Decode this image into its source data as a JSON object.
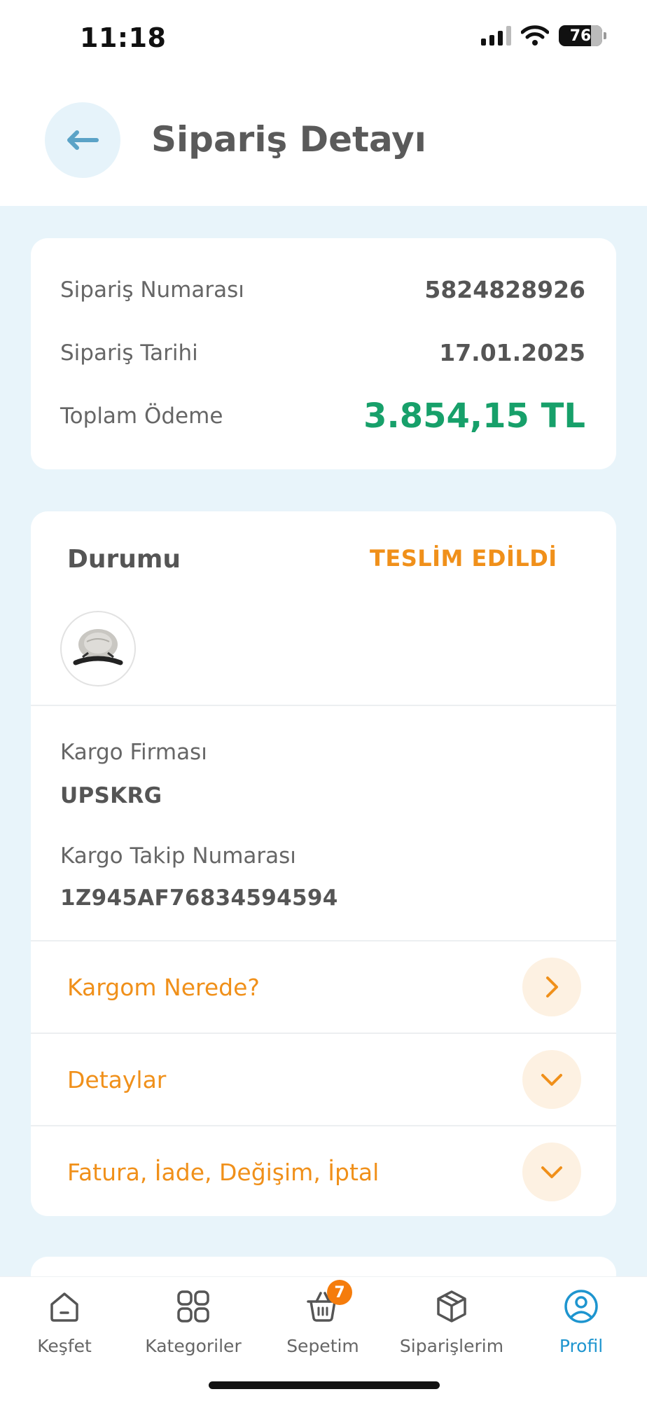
{
  "status_bar": {
    "time": "11:18",
    "battery": "76"
  },
  "header": {
    "title": "Sipariş Detayı"
  },
  "summary": {
    "order_number_label": "Sipariş Numarası",
    "order_number": "5824828926",
    "order_date_label": "Sipariş Tarihi",
    "order_date": "17.01.2025",
    "total_label": "Toplam Ödeme",
    "total": "3.854,15 TL"
  },
  "order_status": {
    "label": "Durumu",
    "value": "TESLİM EDİLDİ",
    "cargo_company_label": "Kargo Firması",
    "cargo_company": "UPSKRG",
    "tracking_label": "Kargo Takip Numarası",
    "tracking_number": "1Z945AF76834594594"
  },
  "actions": {
    "where_is_cargo": "Kargom Nerede?",
    "details": "Detaylar",
    "invoice_return": "Fatura, İade, Değişim, İptal"
  },
  "tab_bar": {
    "items": [
      {
        "label": "Keşfet",
        "icon": "home-icon"
      },
      {
        "label": "Kategoriler",
        "icon": "grid-icon"
      },
      {
        "label": "Sepetim",
        "icon": "basket-icon"
      },
      {
        "label": "Siparişlerim",
        "icon": "box-icon"
      },
      {
        "label": "Profil",
        "icon": "profile-icon"
      }
    ],
    "cart_count": "7",
    "active": "Profil"
  },
  "colors": {
    "accent_orange": "#f0901a",
    "total_green": "#17a06a",
    "active_blue": "#1e95cf",
    "background": "#e8f4fa"
  }
}
